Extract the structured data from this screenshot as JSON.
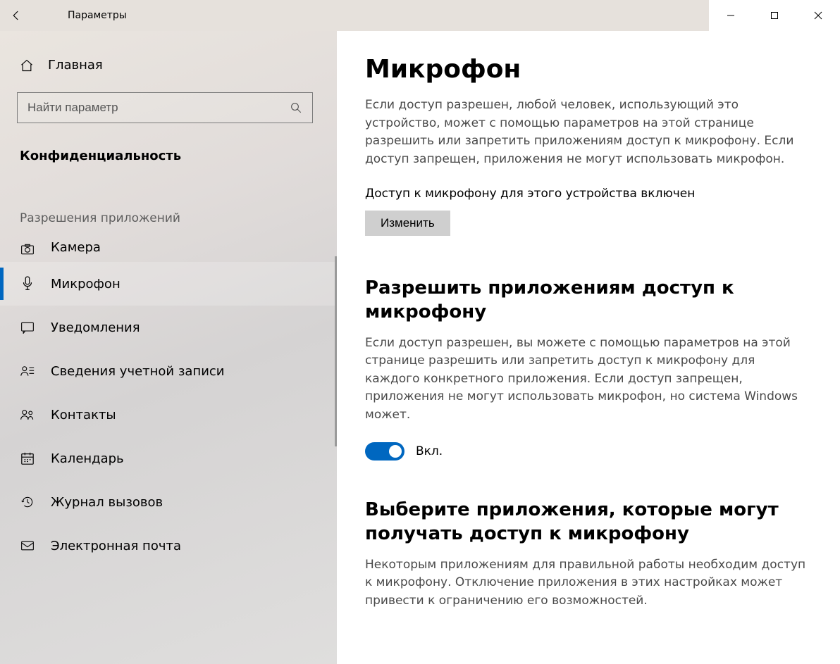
{
  "titlebar": {
    "title": "Параметры"
  },
  "sidebar": {
    "home_label": "Главная",
    "search_placeholder": "Найти параметр",
    "section": "Конфиденциальность",
    "group": "Разрешения приложений",
    "items": {
      "camera": "Камера",
      "microphone": "Микрофон",
      "notifications": "Уведомления",
      "account": "Сведения учетной записи",
      "contacts": "Контакты",
      "calendar": "Календарь",
      "calllog": "Журнал вызовов",
      "email": "Электронная почта"
    }
  },
  "main": {
    "h1": "Микрофон",
    "desc1": "Если доступ разрешен, любой человек, использующий это устройство, может с помощью параметров на этой странице разрешить или запретить приложениям доступ к микрофону. Если доступ запрещен, приложения не могут использовать микрофон.",
    "status": "Доступ к микрофону для этого устройства включен",
    "change": "Изменить",
    "h2a": "Разрешить приложениям доступ к микрофону",
    "desc2": "Если доступ разрешен, вы можете с помощью параметров на этой странице разрешить или запретить доступ к микрофону для каждого конкретного приложения. Если доступ запрещен, приложения не могут использовать микрофон, но система Windows может.",
    "toggle_label": "Вкл.",
    "h2b": "Выберите приложения, которые могут получать доступ к микрофону",
    "desc3": "Некоторым приложениям для правильной работы необходим доступ к микрофону. Отключение приложения в этих настройках может привести к ограничению его возможностей."
  }
}
